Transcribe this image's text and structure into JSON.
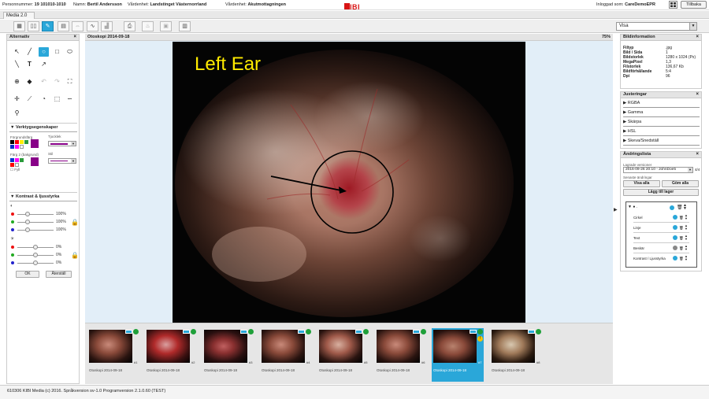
{
  "topbar": {
    "patient_label": "Personnummer:",
    "patient_id": "19 101010-1010",
    "name_label": "Namn:",
    "name": "Bertil Andersson",
    "unit_label": "Vårdenhet:",
    "unit": "Landstinget Västernorrland",
    "care_label": "Vårdenhet:",
    "care_unit": "Akutmottagningen",
    "logo_text": "KIBI",
    "logged_in_label": "Inloggad som:",
    "logged_in_user": "CareDemoEPR",
    "back_button": "Tillbaka"
  },
  "tab": {
    "label": "Media 2.0"
  },
  "toolbar": {
    "buttons": [
      "grid-4-icon",
      "grid-2-icon",
      "pen-icon",
      "film-icon",
      "compare-icon",
      "waveform-icon",
      "chart-icon",
      "print-icon",
      "fire-icon",
      "save-icon",
      "calc-icon"
    ],
    "view_select": "Visa",
    "active_index": 2
  },
  "left_panel": {
    "title": "Alternativ",
    "tool_props_title": "Verktygsegenskaper",
    "color1_label": "Förgrundsfärg",
    "thickness_label": "Tjocklek",
    "color2_label": "Färg 2 (bakgrund)",
    "style_label": "Stil",
    "fill_label": "Fyll",
    "contrast_title": "Kontrast & ljusstyrka",
    "percent_100": "100%",
    "percent_0": "0%",
    "ok_button": "OK",
    "reset_button": "Återställ",
    "colors": [
      "#000000",
      "#ff0000",
      "#ffee00",
      "#2a9b3a",
      "#0033cc",
      "#ff00ff",
      "#880088",
      "#ffffff"
    ]
  },
  "viewer": {
    "header_title": "Otoskopi 2014-09-18",
    "zoom": "75%",
    "image_label": "Left Ear",
    "annotation_color": "#ffeb00"
  },
  "thumbnails": [
    {
      "caption": "Otoskopi 2014-09-18",
      "num": "#1",
      "selected": false
    },
    {
      "caption": "Otoskopi 2014-09-18",
      "num": "#2",
      "selected": false
    },
    {
      "caption": "Otoskopi 2014-09-18",
      "num": "#3",
      "selected": false
    },
    {
      "caption": "Otoskopi 2014-09-18",
      "num": "#4",
      "selected": false
    },
    {
      "caption": "Otoskopi 2014-09-18",
      "num": "#5",
      "selected": false
    },
    {
      "caption": "Otoskopi 2014-09-18",
      "num": "#6",
      "selected": false
    },
    {
      "caption": "Otoskopi 2014-09-18",
      "num": "#7",
      "selected": true
    },
    {
      "caption": "Otoskopi 2014-09-18",
      "num": "#8",
      "selected": false
    }
  ],
  "right_panel": {
    "info_title": "Bildinformation",
    "info": [
      {
        "k": "Filtyp",
        "v": ".jpg"
      },
      {
        "k": "Bild / Sida",
        "v": "1"
      },
      {
        "k": "Bildstorlek",
        "v": "1280 x 1024 (Px)"
      },
      {
        "k": "MegaPixel",
        "v": "1,3"
      },
      {
        "k": "Filstorlek",
        "v": "136,67 Kb"
      },
      {
        "k": "Bildförhållande",
        "v": "5:4"
      },
      {
        "k": "Dpi",
        "v": "96"
      }
    ],
    "adjust_title": "Justeringar",
    "adjustments": [
      "RGBA",
      "Gamma",
      "Skärpa",
      "HSL",
      "Skeva/Snedställ"
    ],
    "changes_title": "Ändringslista",
    "saved_versions_label": "Lagrade versioner",
    "version_value": "2016-09-26 20:10 - JohnDoe5",
    "version_count": "4/4",
    "recent_changes_label": "Senaste ändringar",
    "show_all": "Visa alla",
    "hide_all": "Göm alla",
    "add_layer": "Lägg till lager",
    "layers": [
      "Cirkel",
      "Linje",
      "Text",
      "Beskär",
      "Kontrast / Ljusstyrka"
    ]
  },
  "footer": {
    "text": "610306 KIBI Media (c) 2016. Språkversion sv-1.0 Programversion 2.1.0.60 (TEST)"
  }
}
